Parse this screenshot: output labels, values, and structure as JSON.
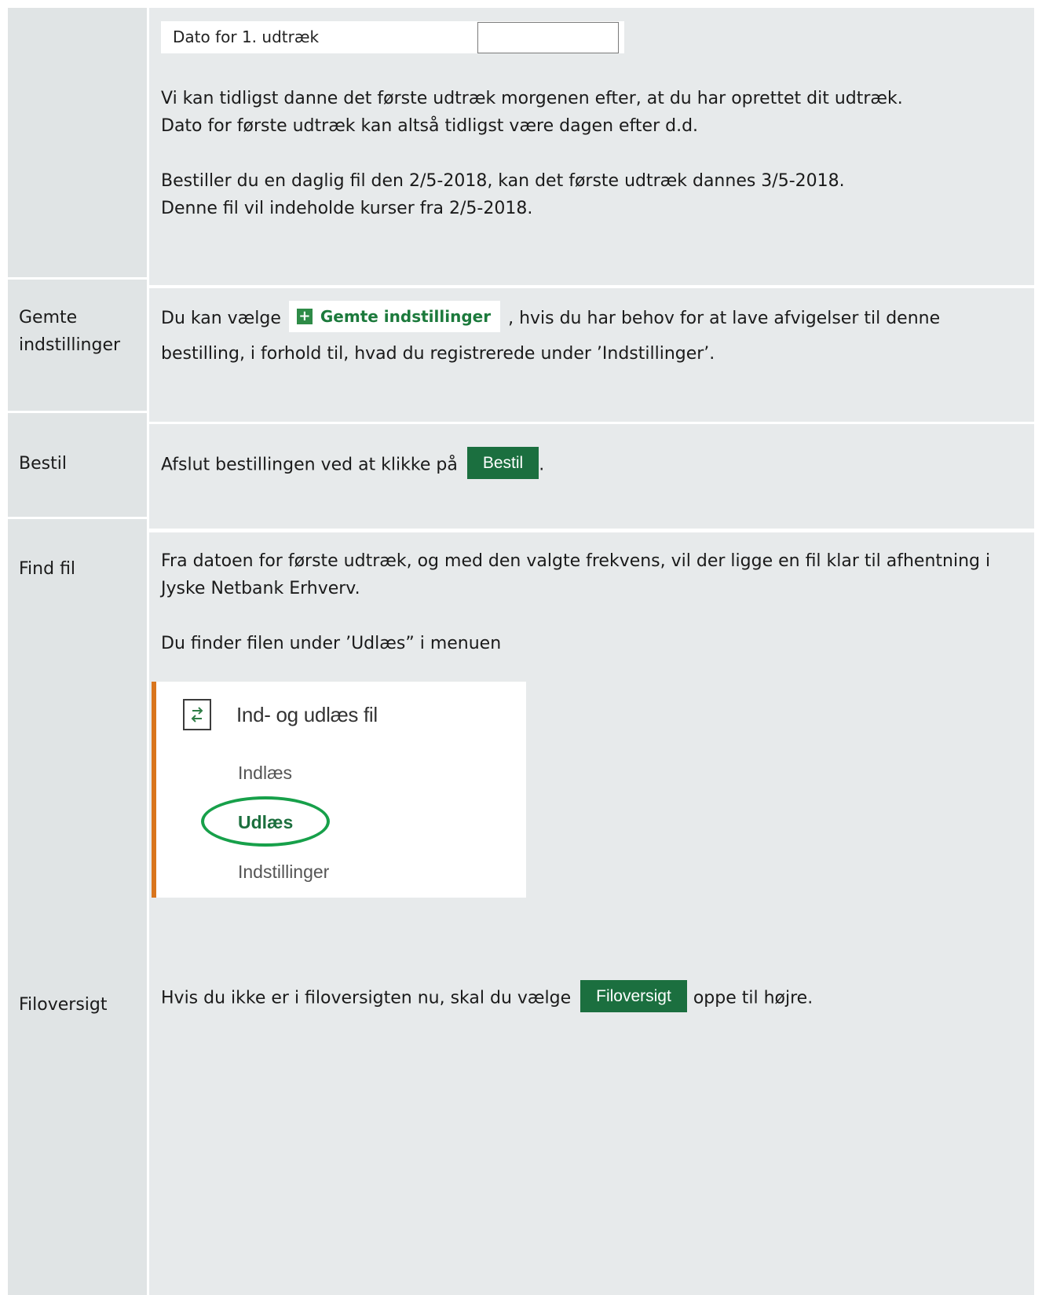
{
  "top": {
    "date_label": "Dato for 1. udtræk",
    "date_value": "",
    "para1_line1": "Vi kan tidligst danne det første udtræk morgenen efter, at du har oprettet dit udtræk.",
    "para1_line2": "Dato for første udtræk kan altså tidligst være dagen efter d.d.",
    "para2_line1": "Bestiller du en daglig fil den 2/5-2018, kan det første udtræk dannes 3/5-2018.",
    "para2_line2": "Denne fil vil indeholde kurser fra 2/5-2018."
  },
  "gemte": {
    "label_line1": "Gemte",
    "label_line2": "indstillinger",
    "text_before": "Du kan vælge",
    "button_label": "Gemte indstillinger",
    "text_after": ", hvis du har behov for at lave afvigelser til denne",
    "line2": "bestilling, i forhold til, hvad du registrerede under ’Indstillinger’."
  },
  "bestil": {
    "label": "Bestil",
    "text_before": "Afslut bestillingen ved at klikke på",
    "button_label": "Bestil",
    "text_after": "."
  },
  "find": {
    "label": "Find fil",
    "line1": "Fra datoen for første udtræk, og med den valgte frekvens, vil der ligge en fil klar til afhentning i",
    "line2": "Jyske Netbank Erhverv.",
    "line3": "Du finder filen under ’Udlæs” i menuen"
  },
  "menu": {
    "title": "Ind- og udlæs fil",
    "items": [
      "Indlæs",
      "Udlæs",
      "Indstillinger"
    ],
    "active_index": 1,
    "highlight_color": "#17a04a",
    "accent_color": "#d9751d",
    "icon": "swap-arrows-icon"
  },
  "filoversigt": {
    "label": "Filoversigt",
    "text_before": "Hvis du ikke er i filoversigten nu, skal du vælge",
    "button_label": "Filoversigt",
    "text_after": "oppe til højre."
  }
}
